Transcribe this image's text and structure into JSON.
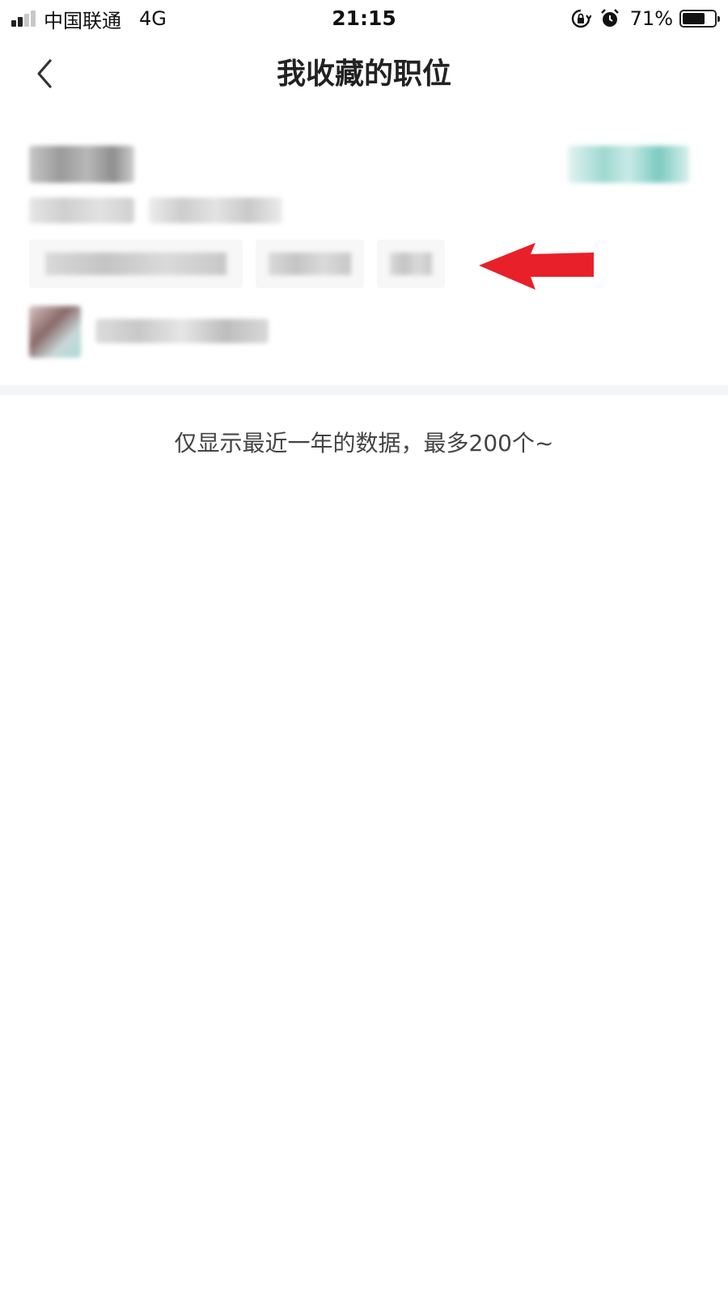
{
  "status_bar": {
    "carrier": "中国联通",
    "network": "4G",
    "time": "21:15",
    "battery_percent": "71%",
    "battery_level": 0.71,
    "icons": [
      "signal-icon",
      "rotation-lock-icon",
      "alarm-icon",
      "battery-icon"
    ]
  },
  "nav": {
    "title": "我收藏的职位",
    "back_icon": "chevron-left-icon"
  },
  "job_list": {
    "items": [
      {
        "content_redacted": true
      }
    ],
    "annotation": {
      "arrow_icon": "red-arrow-left-icon",
      "color": "#e8202a"
    }
  },
  "footer": {
    "note": "仅显示最近一年的数据，最多200个~"
  },
  "colors": {
    "accent": "#5fc4b8",
    "background": "#ffffff",
    "divider": "#f4f5f7"
  }
}
